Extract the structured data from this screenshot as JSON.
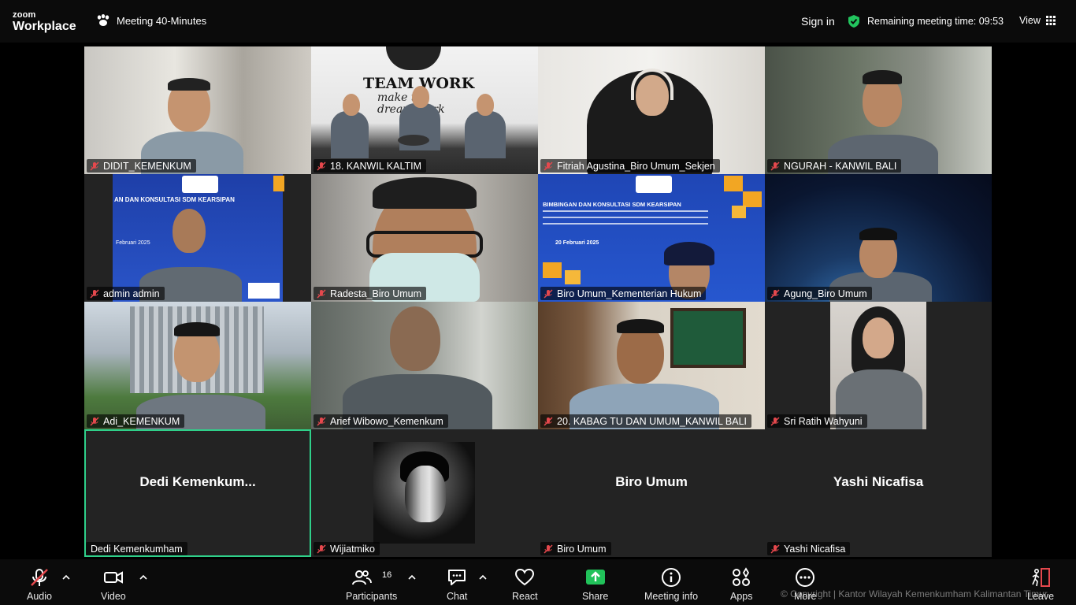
{
  "app": {
    "logo_top": "zoom",
    "logo_bottom": "Workplace"
  },
  "header": {
    "meeting_title": "Meeting 40-Minutes",
    "sign_in": "Sign in",
    "remaining": "Remaining meeting time: 09:53",
    "view": "View"
  },
  "tiles": [
    {
      "name": "DIDIT_KEMENKUM",
      "muted": true
    },
    {
      "name": "18. KANWIL KALTIM",
      "muted": true,
      "banner": "TEAM WORK",
      "banner2": "make the dream work"
    },
    {
      "name": "Fitriah Agustina_Biro Umum_Sekjen",
      "muted": true
    },
    {
      "name": "NGURAH - KANWIL BALI",
      "muted": true
    },
    {
      "name": "admin admin",
      "muted": true,
      "slide_title": "AN DAN KONSULTASI SDM KEARSIPAN",
      "slide_date": "Februari 2025"
    },
    {
      "name": "Radesta_Biro Umum",
      "muted": true
    },
    {
      "name": "Biro Umum_Kementerian Hukum",
      "muted": true,
      "slide_title": "BIMBINGAN DAN KONSULTASI SDM KEARSIPAN",
      "slide_date": "20 Februari 2025"
    },
    {
      "name": "Agung_Biro Umum",
      "muted": true
    },
    {
      "name": "Adi_KEMENKUM",
      "muted": true
    },
    {
      "name": "Arief Wibowo_Kemenkum",
      "muted": true
    },
    {
      "name": "20. KABAG TU DAN UMUM_KANWIL BALI",
      "muted": true
    },
    {
      "name": "Sri Ratih Wahyuni",
      "muted": true
    },
    {
      "name": "Dedi Kemenkumham",
      "muted": false,
      "display": "Dedi  Kemenkum..."
    },
    {
      "name": "Wijiatmiko",
      "muted": true
    },
    {
      "name": "Biro Umum",
      "muted": true,
      "display": "Biro Umum"
    },
    {
      "name": "Yashi Nicafisa",
      "muted": true,
      "display": "Yashi Nicafisa"
    }
  ],
  "toolbar": {
    "audio": "Audio",
    "video": "Video",
    "participants": "Participants",
    "participants_count": "16",
    "chat": "Chat",
    "react": "React",
    "share": "Share",
    "meeting_info": "Meeting info",
    "apps": "Apps",
    "more": "More",
    "leave": "Leave"
  },
  "watermark": "© Copyright | Kantor Wilayah Kemenkumham Kalimantan Timur",
  "colors": {
    "share_green": "#21c25a",
    "active_speaker": "#2fd08a",
    "muted_red": "#e5484d",
    "shield_green": "#22c55e"
  }
}
